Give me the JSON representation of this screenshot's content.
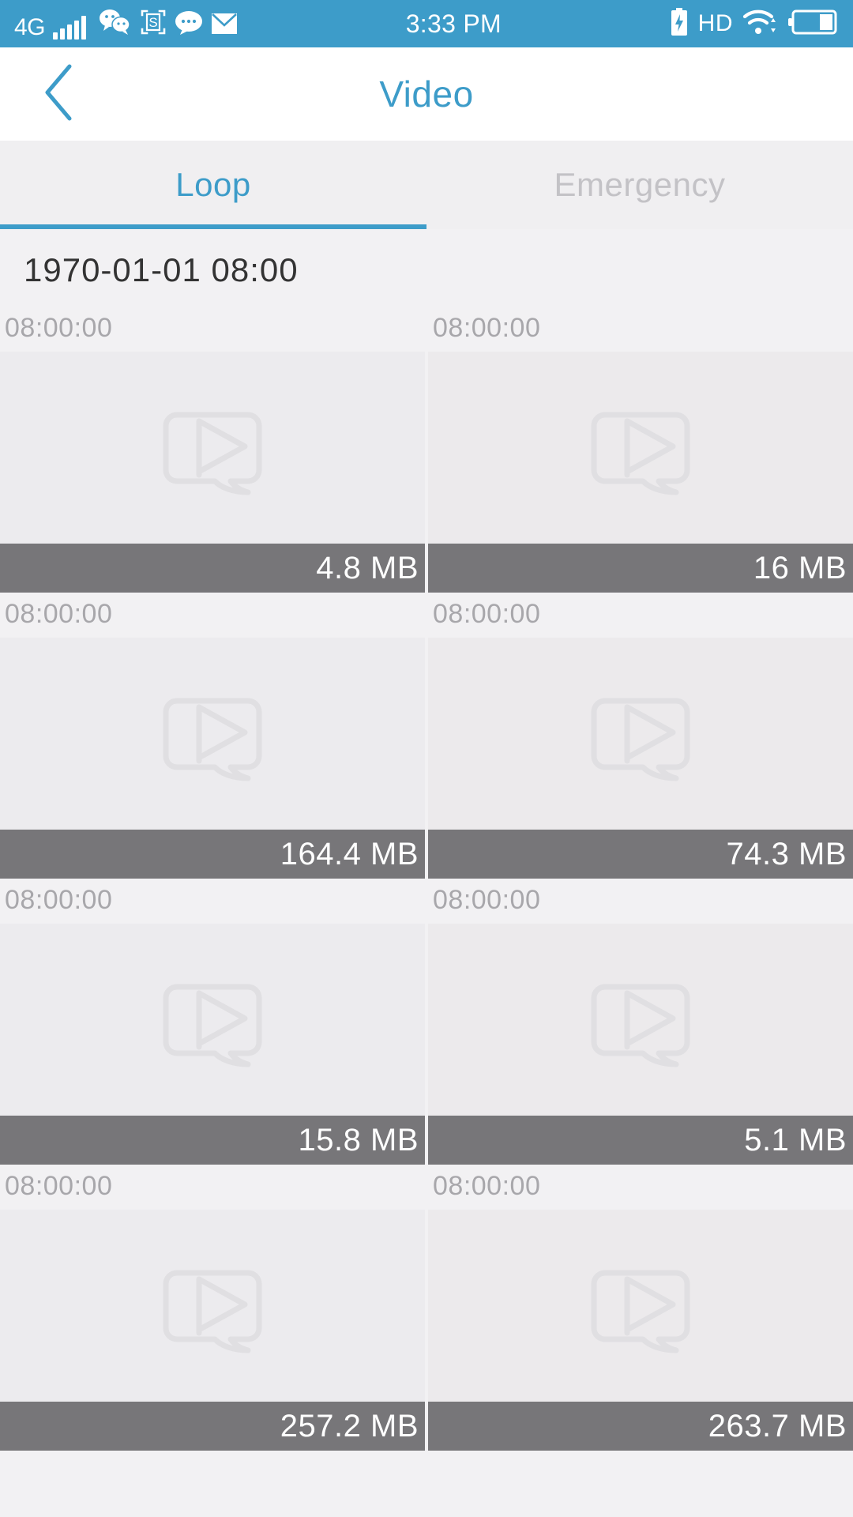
{
  "statusbar": {
    "network_label": "4G",
    "icons_left": [
      "signal-bars-icon",
      "wechat-icon",
      "screenshot-s-icon",
      "chat-bubble-icon",
      "mail-icon"
    ],
    "time": "3:33 PM",
    "hd_label": "HD",
    "icons_right": [
      "battery-charging-icon",
      "wifi-icon",
      "battery-icon"
    ]
  },
  "navbar": {
    "back_icon": "chevron-left-icon",
    "title": "Video"
  },
  "tabs": [
    {
      "label": "Loop",
      "active": true
    },
    {
      "label": "Emergency",
      "active": false
    }
  ],
  "content": {
    "date_header": "1970-01-01 08:00",
    "items": [
      {
        "time": "08:00:00",
        "size": "4.8 MB",
        "placeholder_icon": "video-play-placeholder-icon"
      },
      {
        "time": "08:00:00",
        "size": "16 MB",
        "placeholder_icon": "video-play-placeholder-icon"
      },
      {
        "time": "08:00:00",
        "size": "164.4 MB",
        "placeholder_icon": "video-play-placeholder-icon"
      },
      {
        "time": "08:00:00",
        "size": "74.3 MB",
        "placeholder_icon": "video-play-placeholder-icon"
      },
      {
        "time": "08:00:00",
        "size": "15.8 MB",
        "placeholder_icon": "video-play-placeholder-icon"
      },
      {
        "time": "08:00:00",
        "size": "5.1 MB",
        "placeholder_icon": "video-play-placeholder-icon"
      },
      {
        "time": "08:00:00",
        "size": "257.2 MB",
        "placeholder_icon": "video-play-placeholder-icon"
      },
      {
        "time": "08:00:00",
        "size": "263.7 MB",
        "placeholder_icon": "video-play-placeholder-icon"
      }
    ]
  },
  "colors": {
    "accent": "#3d9cc9",
    "statusbar_bg": "#3d9cc9",
    "page_bg": "#f2f1f3",
    "tab_bg": "#f0eff1",
    "size_bar_bg": "#777679",
    "inactive_tab": "#c3c2c6",
    "timestamp": "#a8a7ab"
  }
}
